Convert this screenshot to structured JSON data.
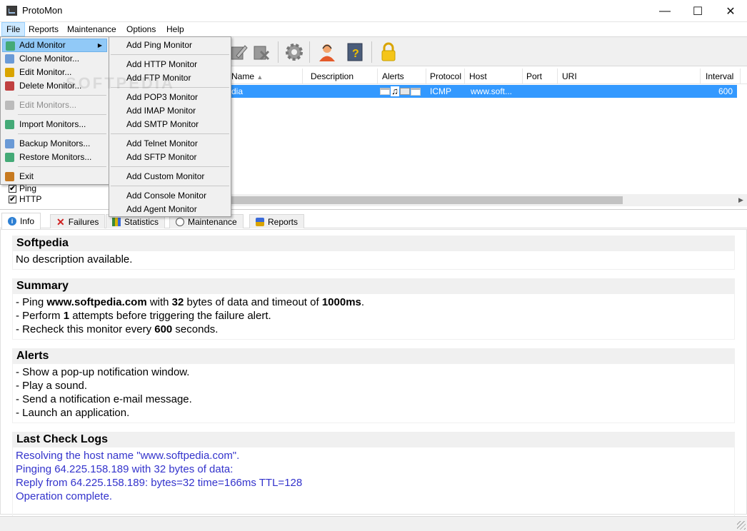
{
  "window": {
    "title": "ProtoMon",
    "minimize": "—",
    "maximize": "☐",
    "close": "✕"
  },
  "menubar": [
    {
      "label": "File"
    },
    {
      "label": "Reports"
    },
    {
      "label": "Maintenance"
    },
    {
      "label": "Options"
    },
    {
      "label": "Help"
    }
  ],
  "toolbar": {
    "icons": [
      "edit-monitor-icon",
      "delete-monitor-icon",
      "settings-gear-icon",
      "support-icon",
      "help-book-icon",
      "lock-icon"
    ]
  },
  "file_menu": {
    "items": [
      {
        "label": "Add Monitor",
        "icon": "add-monitor-icon"
      },
      {
        "label": "Clone Monitor...",
        "icon": "clone-monitor-icon"
      },
      {
        "label": "Edit Monitor...",
        "icon": "edit-monitor-icon"
      },
      {
        "label": "Delete Monitor...",
        "icon": "delete-monitor-icon"
      },
      {
        "label": "Edit Monitors...",
        "icon": "edit-monitors-icon"
      },
      {
        "label": "Import Monitors...",
        "icon": "import-icon"
      },
      {
        "label": "Backup Monitors...",
        "icon": "backup-icon"
      },
      {
        "label": "Restore Monitors...",
        "icon": "restore-icon"
      },
      {
        "label": "Exit",
        "icon": "exit-icon"
      }
    ]
  },
  "add_monitor_submenu": [
    "Add Ping Monitor",
    "Add HTTP Monitor",
    "Add FTP Monitor",
    "Add POP3 Monitor",
    "Add IMAP Monitor",
    "Add SMTP Monitor",
    "Add Telnet Monitor",
    "Add SFTP Monitor",
    "Add Custom Monitor",
    "Add Console Monitor",
    "Add Agent Monitor"
  ],
  "grid": {
    "columns": [
      "Name",
      "Description",
      "Alerts",
      "Protocol",
      "Host",
      "Port",
      "URI",
      "Interval"
    ],
    "row": {
      "name": "dia",
      "description": "",
      "protocol": "ICMP",
      "host": "www.soft...",
      "port": "",
      "uri": "",
      "interval": "600"
    }
  },
  "tree": {
    "items": [
      {
        "label": "Ping",
        "checked": true
      },
      {
        "label": "HTTP",
        "checked": true
      }
    ]
  },
  "tabs": [
    {
      "label": "Info",
      "icon": "info-icon"
    },
    {
      "label": "Failures",
      "icon": "failures-x-icon"
    },
    {
      "label": "Statistics",
      "icon": "statistics-icon"
    },
    {
      "label": "Maintenance",
      "icon": "maintenance-clock-icon"
    },
    {
      "label": "Reports",
      "icon": "reports-icon"
    }
  ],
  "info": {
    "name_heading": "Softpedia",
    "description": "No description available.",
    "summary_heading": "Summary",
    "summary": {
      "l1_pre": "- Ping ",
      "host": "www.softpedia.com",
      "l1_mid": " with ",
      "bytes": "32",
      "l1_mid2": " bytes of data and timeout of ",
      "timeout": "1000ms",
      "l1_end": ".",
      "l2_pre": "- Perform ",
      "attempts": "1",
      "l2_end": " attempts before triggering the failure alert.",
      "l3_pre": "- Recheck this monitor every ",
      "seconds": "600",
      "l3_end": " seconds."
    },
    "alerts_heading": "Alerts",
    "alerts": [
      "- Show a pop-up notification window.",
      "- Play a sound.",
      "- Send a notification e-mail message.",
      "- Launch an application."
    ],
    "logs_heading": "Last Check Logs",
    "logs": [
      "Resolving the host name \"www.softpedia.com\".",
      "Pinging 64.225.158.189 with 32 bytes of data:",
      "Reply from 64.225.158.189: bytes=32 time=166ms TTL=128",
      "Operation complete."
    ]
  },
  "watermark": "SOFTPEDIA",
  "colors": {
    "selection": "#3399ff",
    "menu_highlight": "#91c9f7",
    "log_text": "#3333cc"
  }
}
